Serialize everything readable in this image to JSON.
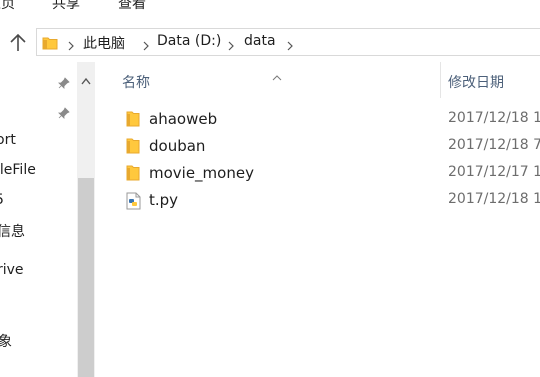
{
  "ribbon": {
    "tabs": [
      {
        "label": "主页"
      },
      {
        "label": "共享"
      },
      {
        "label": "查看"
      }
    ]
  },
  "address": {
    "crumbs": [
      {
        "label": "此电脑"
      },
      {
        "label": "Data (D:)"
      },
      {
        "label": "data"
      }
    ]
  },
  "nav": {
    "items": [
      {
        "label": "ort"
      },
      {
        "label": "ileFile"
      },
      {
        "label": "5"
      },
      {
        "label": "信息"
      },
      {
        "label": "rive"
      },
      {
        "label": "象"
      }
    ]
  },
  "columns": {
    "name": "名称",
    "date": "修改日期"
  },
  "files": [
    {
      "name": "ahaoweb",
      "date": "2017/12/18 1",
      "type": "folder"
    },
    {
      "name": "douban",
      "date": "2017/12/18 7",
      "type": "folder"
    },
    {
      "name": "movie_money",
      "date": "2017/12/17 1",
      "type": "folder"
    },
    {
      "name": "t.py",
      "date": "2017/12/18 1",
      "type": "python-file"
    }
  ],
  "colors": {
    "folder": "#ffc83d",
    "folder_dark": "#e8a92e",
    "header_text": "#4c607a",
    "date_text": "#6d6d6d",
    "link_blue": "#2b7cd3"
  }
}
